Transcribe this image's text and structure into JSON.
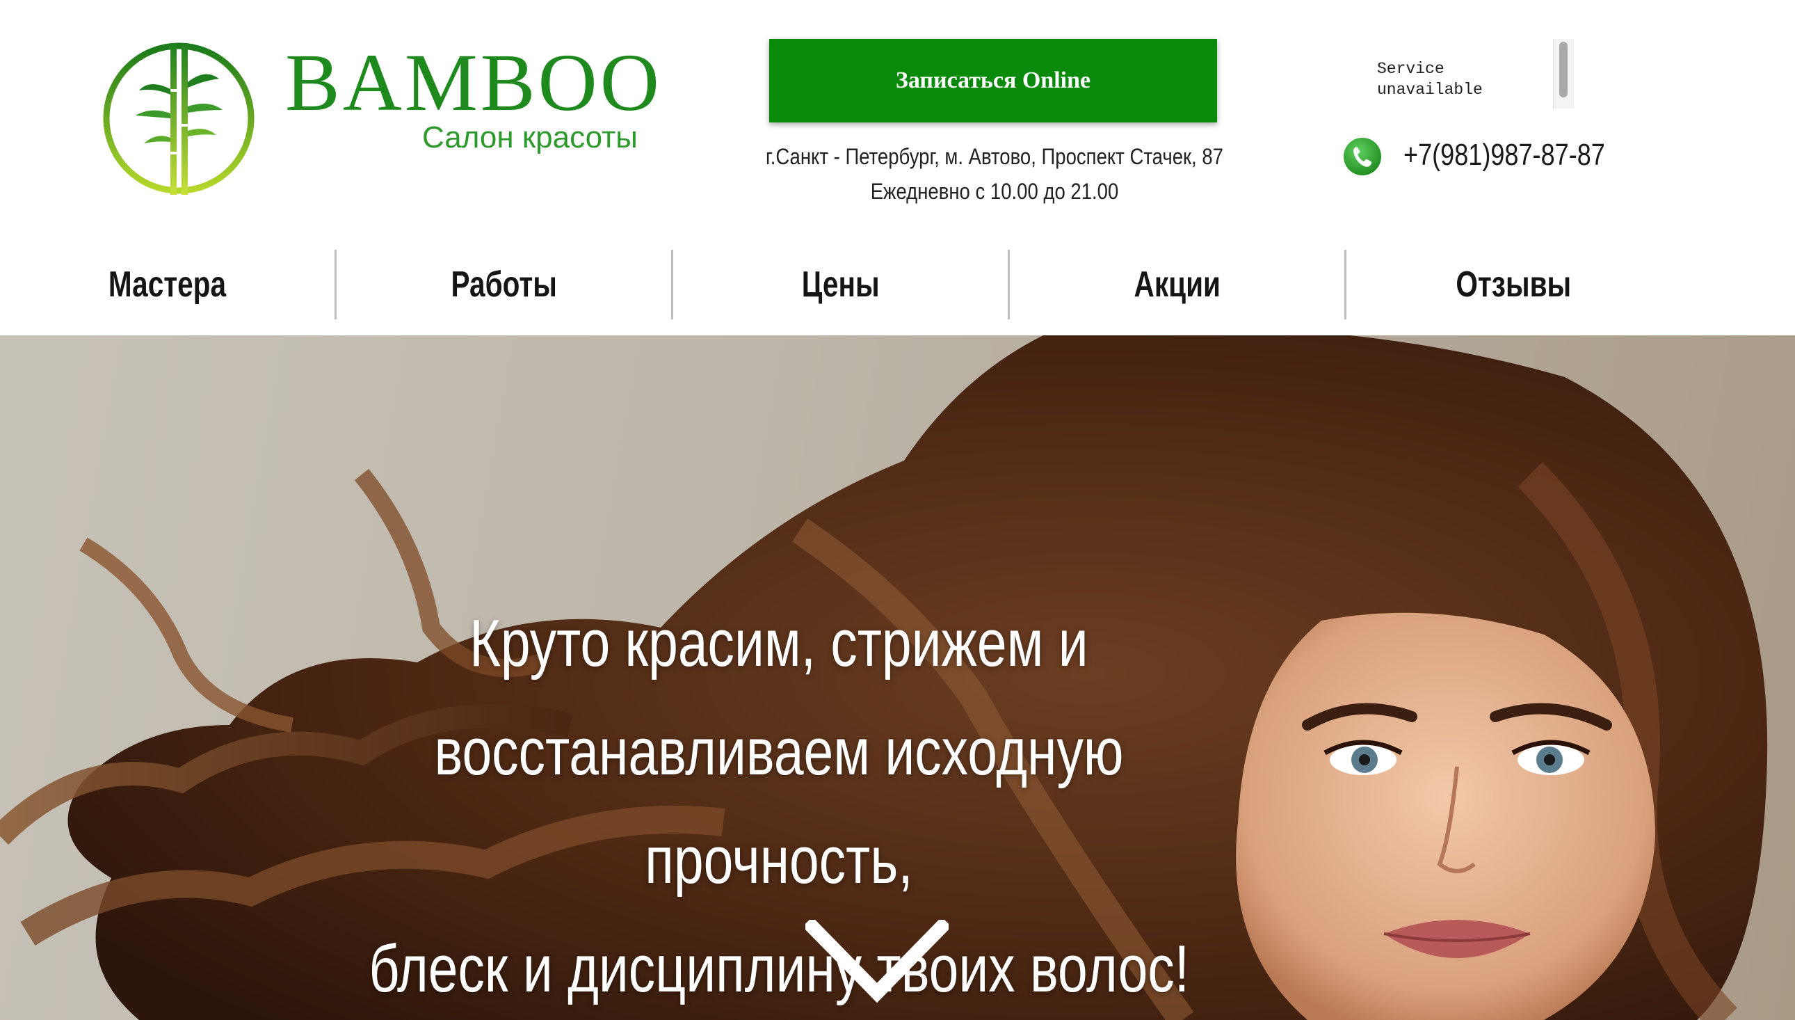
{
  "brand": {
    "name": "BAMBOO",
    "tagline": "Салон красоты"
  },
  "cta": {
    "label": "Записаться Online"
  },
  "contact": {
    "address": "г.Санкт - Петербург, м. Автово, Проспект Стачек, 87",
    "hours": "Ежедневно с 10.00 до 21.00",
    "phone": "+7(981)987-87-87",
    "widget_message_line1": "Service",
    "widget_message_line2": "unavailable"
  },
  "nav": {
    "items": [
      {
        "label": "Мастера"
      },
      {
        "label": "Работы"
      },
      {
        "label": "Цены"
      },
      {
        "label": "Акции"
      },
      {
        "label": "Отзывы"
      }
    ]
  },
  "hero": {
    "line1": "Круто красим, стрижем и",
    "line2": "восстанавливаем исходную прочность,",
    "line3": "блеск и дисциплину твоих волос!"
  },
  "colors": {
    "brand_green": "#1e8a1e",
    "cta_green": "#0a8a0a",
    "phone_green": "#2ea82e"
  },
  "icons": {
    "logo": "bamboo-logo-icon",
    "phone": "phone-icon",
    "scroll": "chevron-down-icon"
  }
}
